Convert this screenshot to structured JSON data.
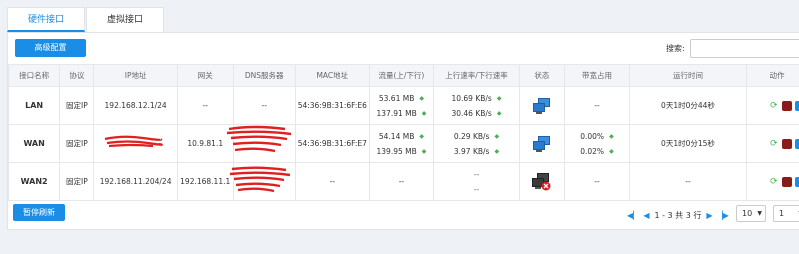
{
  "tabs": [
    {
      "label": "硬件接口"
    },
    {
      "label": "虚拟接口"
    }
  ],
  "toolbar": {
    "advanced_label": "高级配置",
    "search_label": "搜索:",
    "search_value": ""
  },
  "table": {
    "headers": [
      "接口名称",
      "协议",
      "IP地址",
      "网关",
      "DNS服务器",
      "MAC地址",
      "流量(上/下行)",
      "上行速率/下行速率",
      "状态",
      "带宽占用",
      "运行时间",
      "动作"
    ],
    "rows": [
      {
        "name": "LAN",
        "protocol": "固定IP",
        "ip": "192.168.12.1/24",
        "gateway": "--",
        "dns": "--",
        "mac": "54:36:9B:31:6F:E6",
        "traffic_up": "53.61 MB",
        "traffic_down": "137.91 MB",
        "rate_up": "10.69 KB/s",
        "rate_down": "30.46 KB/s",
        "status": "connected",
        "bw_up": "--",
        "bw_down": "",
        "uptime": "0天1时0分44秒"
      },
      {
        "name": "WAN",
        "protocol": "固定IP",
        "ip": "",
        "gateway": "10.9.81.1",
        "dns": "",
        "mac": "54:36:9B:31:6F:E7",
        "traffic_up": "54.14 MB",
        "traffic_down": "139.95 MB",
        "rate_up": "0.29 KB/s",
        "rate_down": "3.97 KB/s",
        "status": "connected",
        "bw_up": "0.00%",
        "bw_down": "0.02%",
        "uptime": "0天1时0分15秒"
      },
      {
        "name": "WAN2",
        "protocol": "固定IP",
        "ip": "192.168.11.204/24",
        "gateway": "192.168.11.1",
        "dns": "",
        "mac": "--",
        "traffic_up": "--",
        "traffic_down": "",
        "rate_up": "--",
        "rate_down": "--",
        "status": "disconnected",
        "bw_up": "--",
        "bw_down": "",
        "uptime": "--"
      }
    ]
  },
  "footer": {
    "refresh_label": "暂停刷新",
    "page_info": "1 - 3 共 3 行",
    "page_size": "10",
    "page_number": "1"
  },
  "colors": {
    "accent": "#1a8ee6",
    "arrow_green": "#4caf50",
    "redaction": "#e02020"
  },
  "icons": [
    "status-connected-icon",
    "status-disconnected-icon",
    "refresh-icon",
    "stop-icon",
    "edit-icon",
    "first-page-icon",
    "prev-page-icon",
    "next-page-icon",
    "last-page-icon"
  ]
}
